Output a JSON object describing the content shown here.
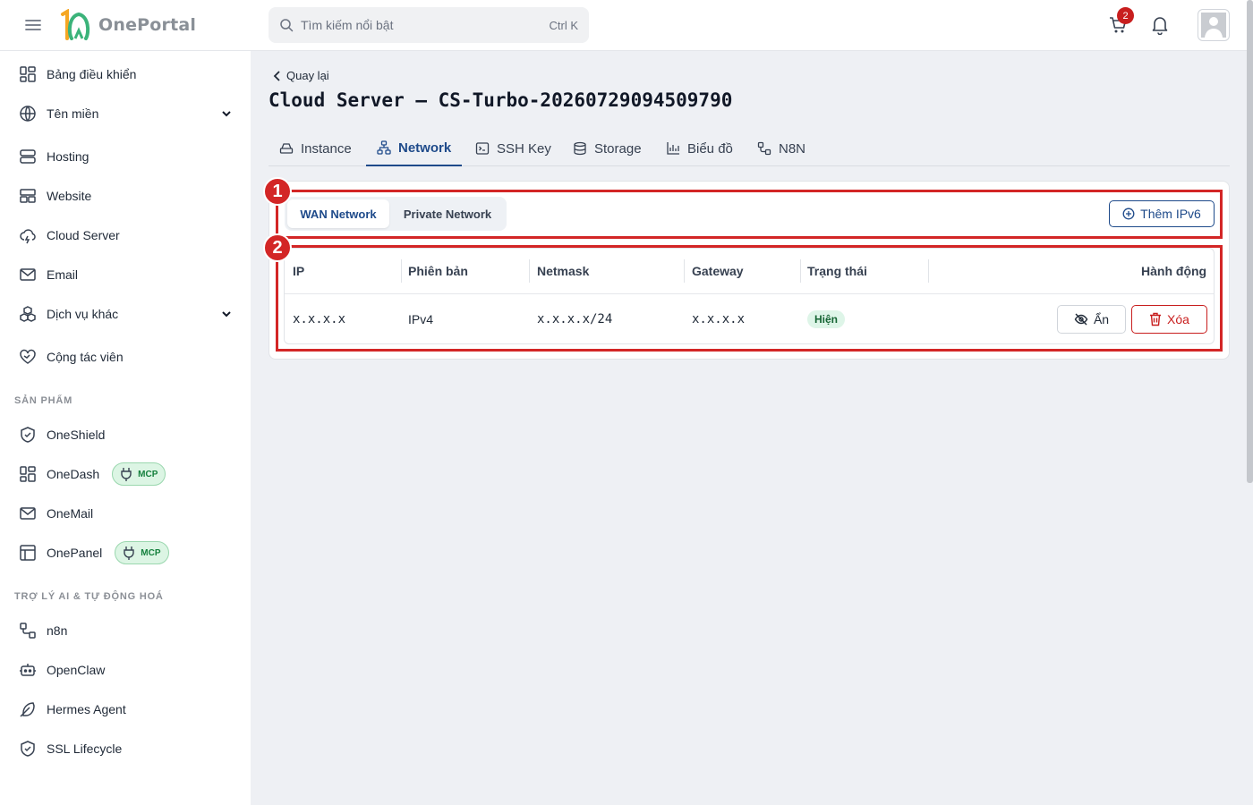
{
  "header": {
    "logo_text": "OnePortal",
    "search_placeholder": "Tìm kiếm nổi bật",
    "search_shortcut": "Ctrl K",
    "cart_count": "2"
  },
  "sidebar": {
    "items": [
      {
        "label": "Bảng điều khiển"
      },
      {
        "label": "Tên miền"
      },
      {
        "label": "Hosting"
      },
      {
        "label": "Website"
      },
      {
        "label": "Cloud Server"
      },
      {
        "label": "Email"
      },
      {
        "label": "Dịch vụ khác"
      },
      {
        "label": "Cộng tác viên"
      }
    ],
    "section_products": "SẢN PHẨM",
    "products": [
      {
        "label": "OneShield"
      },
      {
        "label": "OneDash",
        "badge": "MCP"
      },
      {
        "label": "OneMail"
      },
      {
        "label": "OnePanel",
        "badge": "MCP"
      }
    ],
    "section_ai": "TRỢ LÝ AI & TỰ ĐỘNG HOÁ",
    "ai": [
      {
        "label": "n8n"
      },
      {
        "label": "OpenClaw"
      },
      {
        "label": "Hermes Agent"
      },
      {
        "label": "SSL Lifecycle"
      }
    ]
  },
  "main": {
    "back_label": "Quay lại",
    "title": "Cloud Server — CS-Turbo-20260729094509790",
    "tabs": [
      {
        "label": "Instance"
      },
      {
        "label": "Network"
      },
      {
        "label": "SSH Key"
      },
      {
        "label": "Storage"
      },
      {
        "label": "Biểu đồ"
      },
      {
        "label": "N8N"
      }
    ],
    "network_tabs": {
      "wan": "WAN Network",
      "private": "Private Network"
    },
    "add_ipv6_label": "Thêm IPv6",
    "table": {
      "headers": [
        "IP",
        "Phiên bản",
        "Netmask",
        "Gateway",
        "Trạng thái",
        "Hành động"
      ],
      "rows": [
        {
          "ip": "x.x.x.x",
          "version": "IPv4",
          "netmask": "x.x.x.x/24",
          "gateway": "x.x.x.x",
          "status": "Hiện",
          "hide_label": "Ẩn",
          "delete_label": "Xóa"
        }
      ]
    }
  },
  "annotations": {
    "one": "1",
    "two": "2"
  },
  "colors": {
    "accent": "#1e4a8a",
    "danger": "#c81e1e",
    "annotation": "#d32626",
    "success_bg": "#def5e8"
  }
}
